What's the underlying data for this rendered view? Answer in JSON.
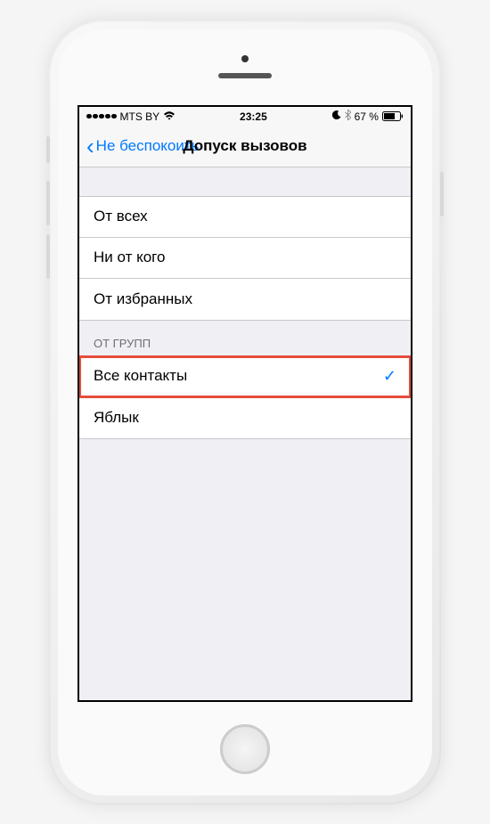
{
  "statusBar": {
    "carrier": "MTS BY",
    "time": "23:25",
    "battery": "67 %"
  },
  "navBar": {
    "backLabel": "Не беспокоить",
    "title": "Допуск вызовов"
  },
  "section1": {
    "items": [
      {
        "label": "От всех",
        "selected": false
      },
      {
        "label": "Ни от кого",
        "selected": false
      },
      {
        "label": "От избранных",
        "selected": false
      }
    ]
  },
  "section2": {
    "header": "ОТ ГРУПП",
    "items": [
      {
        "label": "Все контакты",
        "selected": true,
        "highlighted": true
      },
      {
        "label": "Яблык",
        "selected": false
      }
    ]
  }
}
